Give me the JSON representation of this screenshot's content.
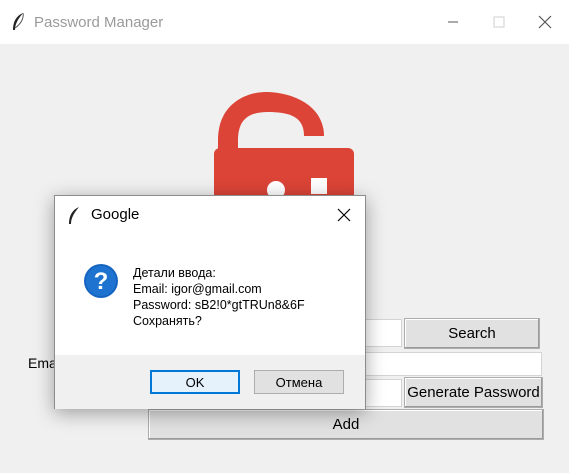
{
  "window": {
    "title": "Password Manager",
    "icon": "feather-icon",
    "controls": [
      "minimize-icon",
      "maximize-icon",
      "close-icon"
    ]
  },
  "logo": {
    "icon": "padlock-icon",
    "color": "#db4437"
  },
  "form": {
    "email_label": "Ema",
    "search_button": "Search",
    "generate_button": "Generate Password",
    "add_button": "Add"
  },
  "dialog": {
    "title": "Google",
    "icon": "question-icon",
    "lines": [
      "Детали ввода:",
      "Email: igor@gmail.com",
      "Password: sB2!0*gtTRUn8&6F",
      "Сохранять?"
    ],
    "ok_label": "OK",
    "cancel_label": "Отмена"
  }
}
